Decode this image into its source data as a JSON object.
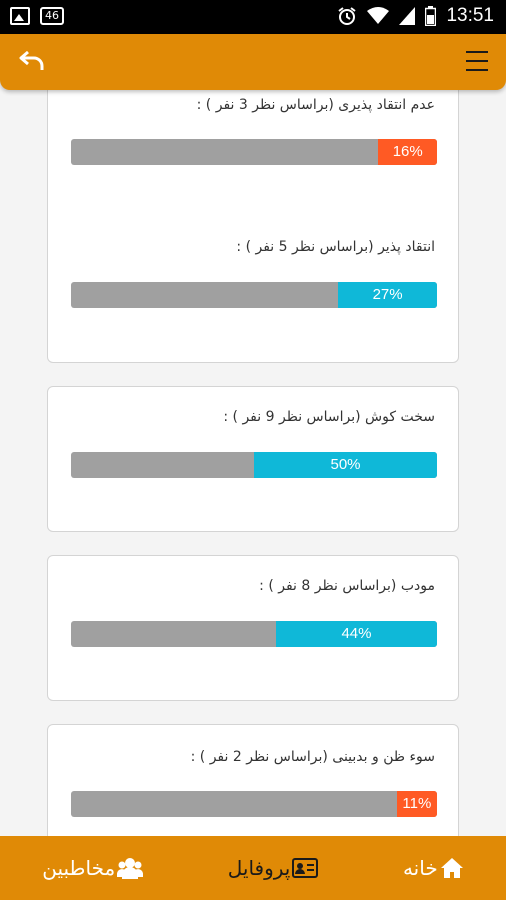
{
  "status_bar": {
    "time": "13:51",
    "notification_badge": "46",
    "icons": [
      "image-icon",
      "badge-icon",
      "alarm-icon",
      "wifi-icon",
      "signal-icon",
      "battery-icon"
    ]
  },
  "app_bar": {
    "back_icon": "back-arrow-icon",
    "menu_icon": "hamburger-menu-icon",
    "color": "#e08a06"
  },
  "traits": [
    {
      "label": "عدم انتقاد پذیری (براساس نظر 3 نفر ) :",
      "percent": 16,
      "percent_text": "16%",
      "color": "#ff5a24"
    },
    {
      "label": "انتقاد پذیر (براساس نظر 5 نفر ) :",
      "percent": 27,
      "percent_text": "27%",
      "color": "#0fb8d8"
    },
    {
      "label": "سخت کوش (براساس نظر 9 نفر ) :",
      "percent": 50,
      "percent_text": "50%",
      "color": "#0fb8d8"
    },
    {
      "label": "مودب (براساس نظر 8 نفر ) :",
      "percent": 44,
      "percent_text": "44%",
      "color": "#0fb8d8"
    },
    {
      "label": "سوء ظن و بدبینی (براساس نظر 2 نفر ) :",
      "percent": 11,
      "percent_text": "11%",
      "color": "#ff5a24"
    }
  ],
  "bottom_nav": {
    "home": {
      "label": "خانه",
      "icon": "home-icon"
    },
    "profile": {
      "label": "پروفایل",
      "icon": "id-card-icon"
    },
    "contacts": {
      "label": "مخاطبین",
      "icon": "group-icon"
    }
  }
}
